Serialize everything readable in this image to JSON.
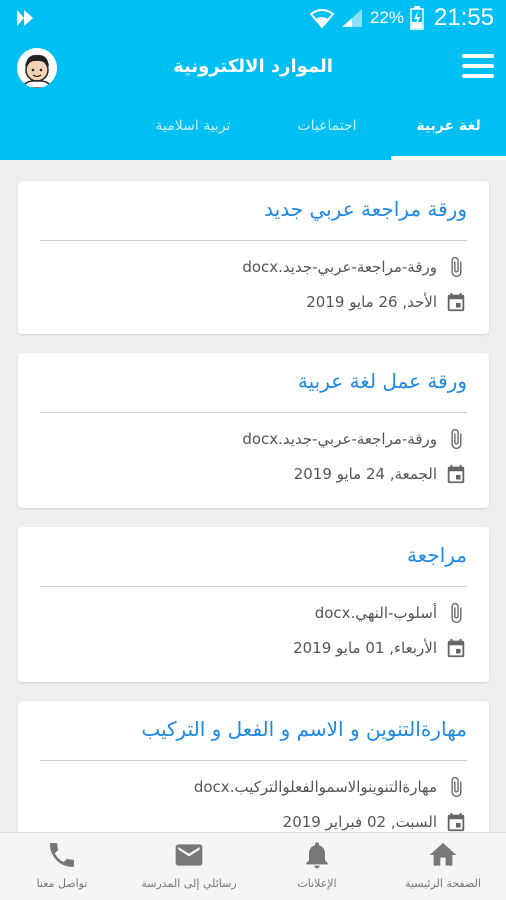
{
  "status_bar": {
    "battery_text": "22%",
    "time": "21:55"
  },
  "header": {
    "title": "الموارد الالكترونية",
    "tabs": [
      {
        "label": "لغة عربية",
        "active": true
      },
      {
        "label": "اجتماعيات",
        "active": false
      },
      {
        "label": "تربية اسلامية",
        "active": false
      }
    ]
  },
  "cards": [
    {
      "title": "ورقة مراجعة عربي جديد",
      "file": "ورقة-مراجعة-عربي-جديد.docx",
      "date": "الأحد, 26 مايو 2019"
    },
    {
      "title": "ورقة عمل لغة عربية",
      "file": "ورقة-مراجعة-عربي-جديد.docx",
      "date": "الجمعة, 24 مايو 2019"
    },
    {
      "title": "مراجعة",
      "file": "أسلوب-النهي.docx",
      "date": "الأربعاء, 01 مايو 2019"
    },
    {
      "title": "مهارةالتنوين و الاسم و الفعل و التركيب",
      "file": "مهارةالتنوينوالاسموالفعلوالتركيب.docx",
      "date": "السبت, 02 فبراير 2019"
    }
  ],
  "bottom_nav": [
    {
      "label": "الصفحة الرئيسية",
      "icon": "home-icon"
    },
    {
      "label": "الإعلانات",
      "icon": "bell-icon"
    },
    {
      "label": "رسائلي إلى المدرسة",
      "icon": "mail-icon"
    },
    {
      "label": "تواصل معنا",
      "icon": "phone-icon"
    }
  ],
  "colors": {
    "primary": "#00bff3",
    "title_blue": "#1e88e5",
    "background": "#eeeeee"
  }
}
